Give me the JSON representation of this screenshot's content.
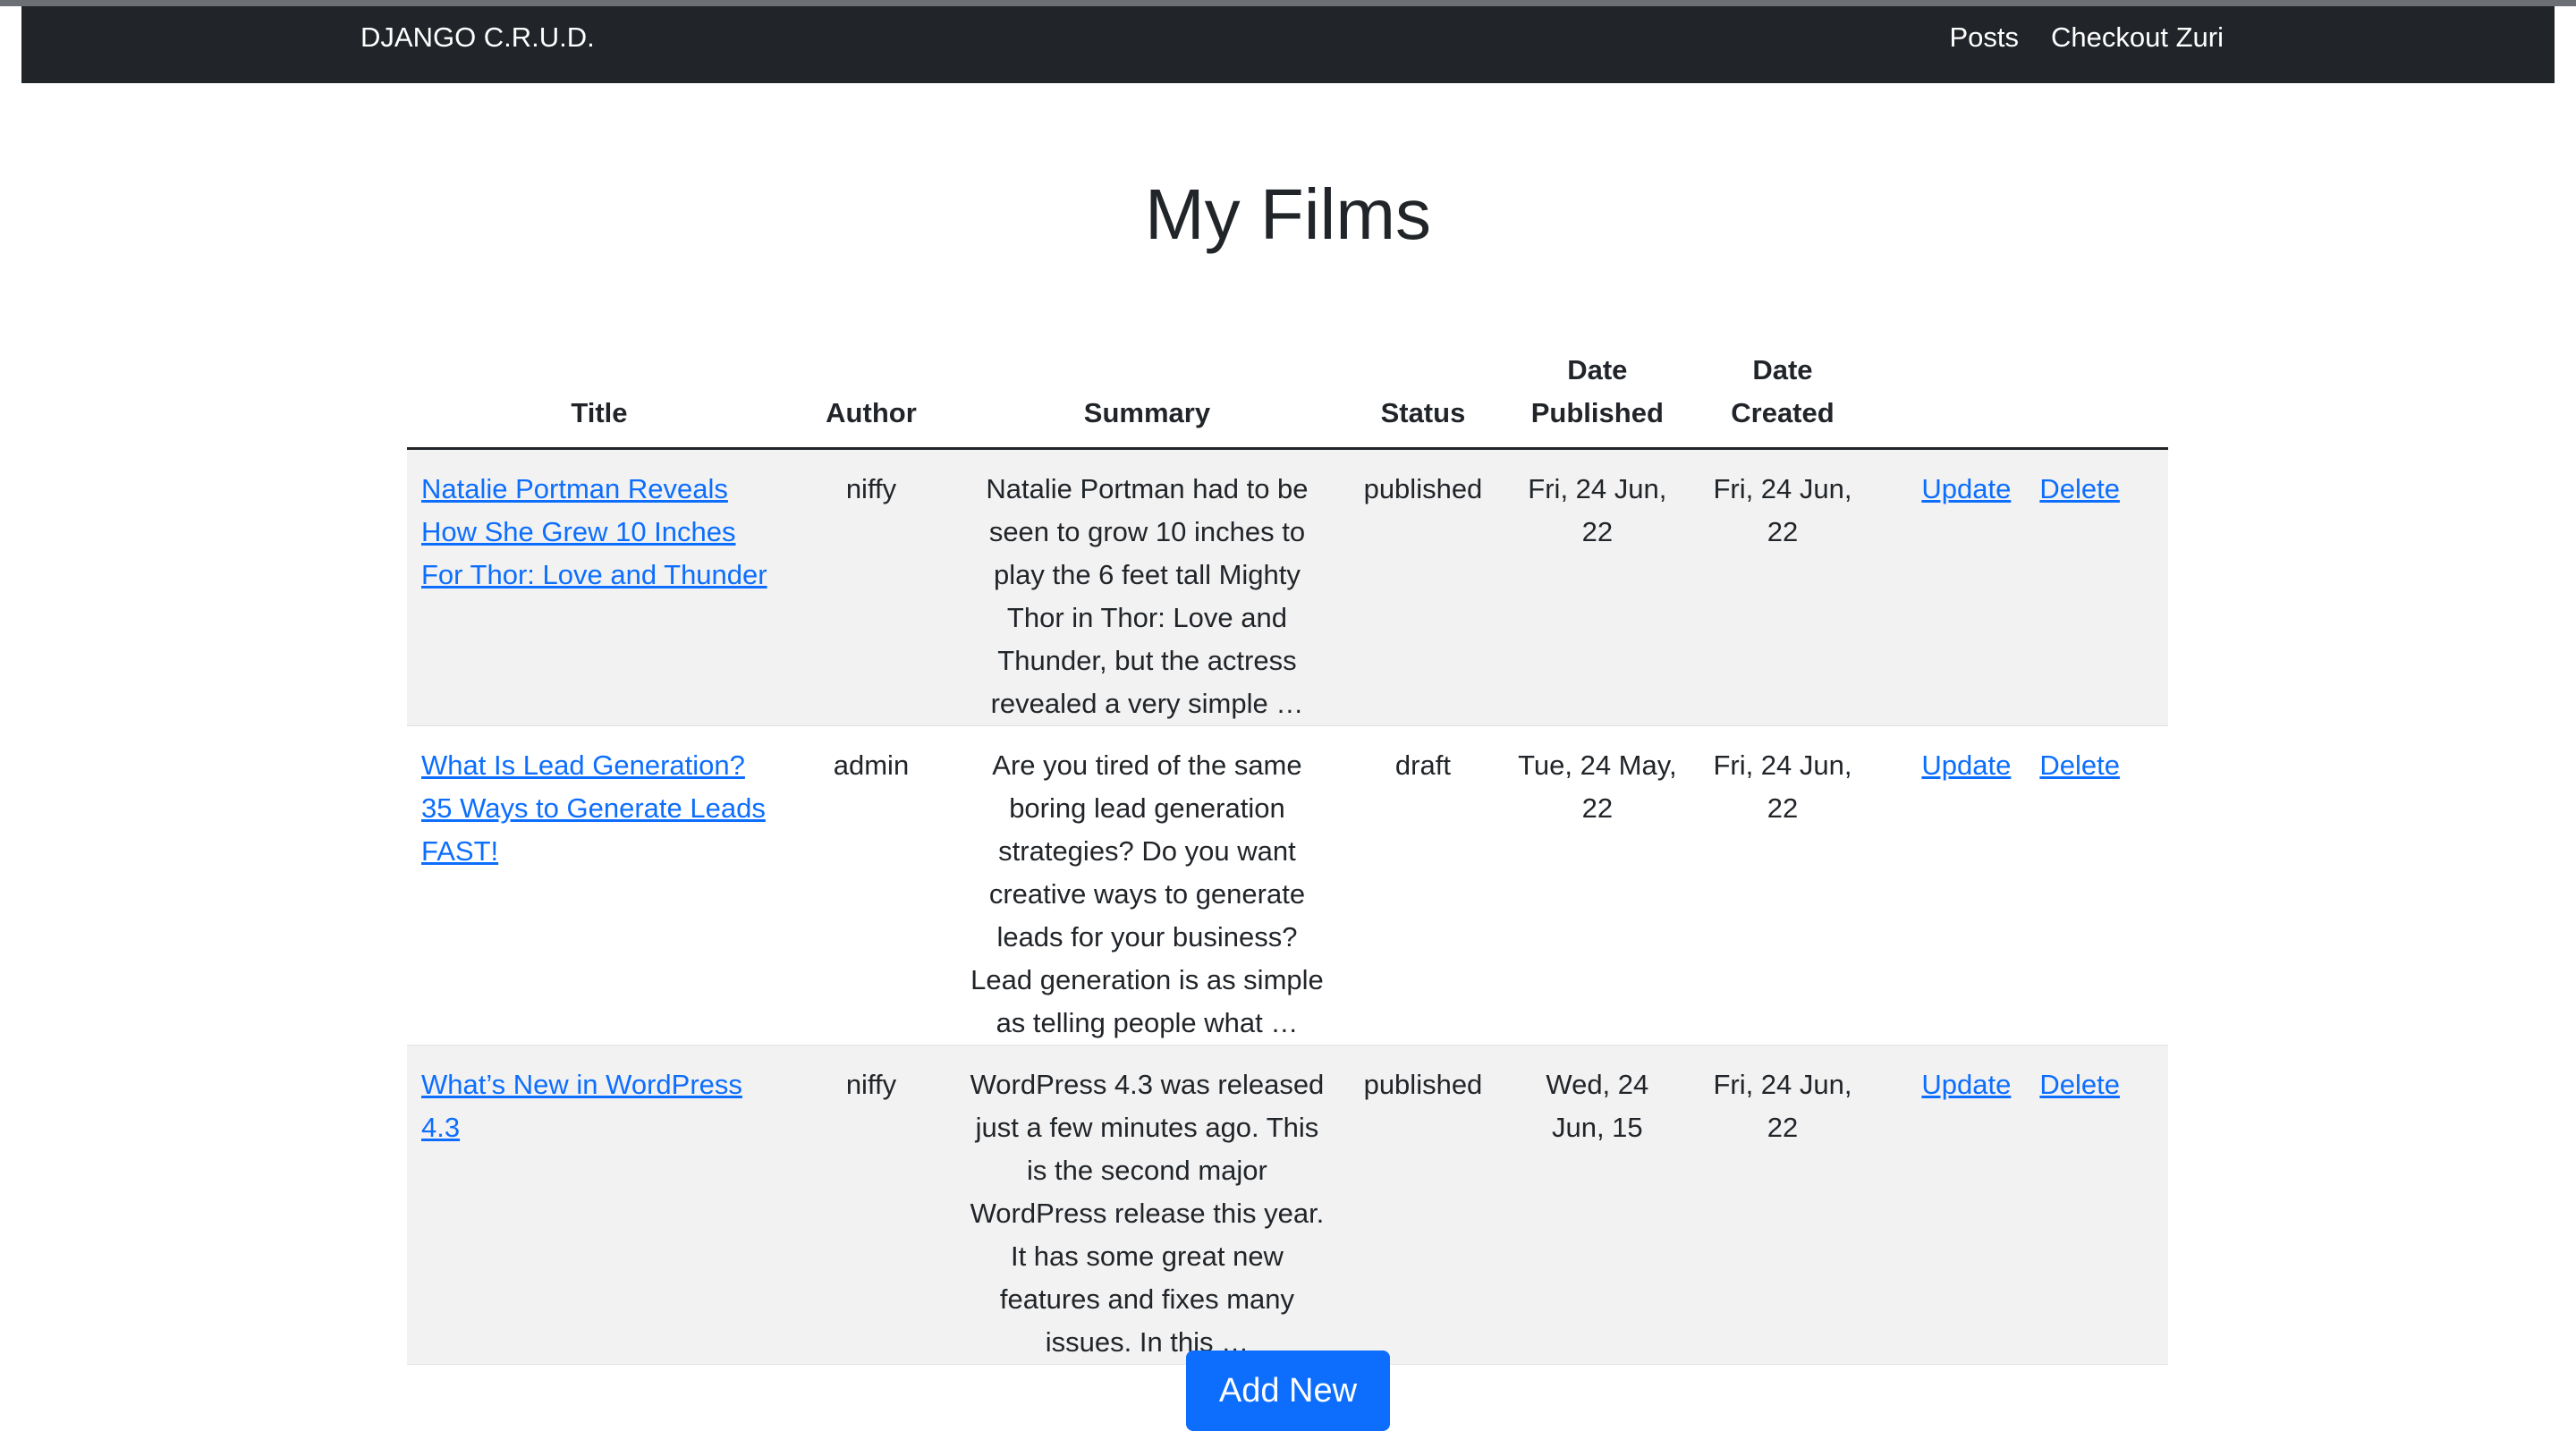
{
  "navbar": {
    "brand": "DJANGO C.R.U.D.",
    "links": [
      "Posts",
      "Checkout Zuri"
    ]
  },
  "page": {
    "title": "My Films"
  },
  "table": {
    "headers": {
      "title": "Title",
      "author": "Author",
      "summary": "Summary",
      "status": "Status",
      "date_published": "Date Published",
      "date_created": "Date Created"
    },
    "rows": [
      {
        "title": "Natalie Portman Reveals How She Grew 10 Inches For Thor: Love and Thunder",
        "author": "niffy",
        "summary": "Natalie Portman had to be seen to grow 10 inches to play the 6 feet tall Mighty Thor in Thor: Love and Thunder, but the actress revealed a very simple …",
        "status": "published",
        "date_published": "Fri, 24 Jun, 22",
        "date_created": "Fri, 24 Jun, 22",
        "update": "Update",
        "delete": "Delete"
      },
      {
        "title": "What Is Lead Generation? 35 Ways to Generate Leads FAST!",
        "author": "admin",
        "summary": "Are you tired of the same boring lead generation strategies? Do you want creative ways to generate leads for your business? Lead generation is as simple as telling people what …",
        "status": "draft",
        "date_published": "Tue, 24 May, 22",
        "date_created": "Fri, 24 Jun, 22",
        "update": "Update",
        "delete": "Delete"
      },
      {
        "title": "What’s New in WordPress 4.3",
        "author": "niffy",
        "summary": "WordPress 4.3 was released just a few minutes ago. This is the second major WordPress release this year. It has some great new features and fixes many issues. In this …",
        "status": "published",
        "date_published": "Wed, 24 Jun, 15",
        "date_created": "Fri, 24 Jun, 22",
        "update": "Update",
        "delete": "Delete"
      }
    ]
  },
  "add_button": {
    "label": "Add New"
  },
  "colors": {
    "navbar_bg": "#212529",
    "link": "#0d6efd",
    "button_bg": "#0d6efd",
    "row_stripe": "#f2f2f2"
  }
}
